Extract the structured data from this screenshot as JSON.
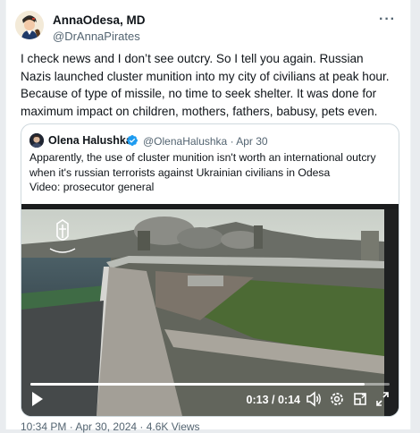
{
  "author": {
    "name": "AnnaOdesa, MD",
    "handle": "@DrAnnaPirates"
  },
  "more_label": "···",
  "tweet_text": "I check news and I don’t see outcry. So I tell you again. Russian Nazis launched cluster munition into my city of civilians at peak hour. Because of type of missile, no time to seek shelter. It was done for maximum impact on children, mothers, fathers, babusy, pets even.",
  "quote": {
    "name": "Olena Halushka",
    "handle": "@OlenaHalushka",
    "separator": "·",
    "date": "Apr 30",
    "text_line1": "Apparently, the use of cluster munition isn't worth an international outcry",
    "text_line2": "when it's russian terrorists against Ukrainian civilians in Odesa",
    "text_line3": "Video: prosecutor general"
  },
  "video": {
    "current_time": "0:13",
    "duration": "0:14",
    "time_separator": " / ",
    "progress": 0.93
  },
  "icons": {
    "play": "play-icon",
    "volume": "volume-icon",
    "settings": "settings-icon",
    "pip": "picture-in-picture-icon",
    "fullscreen": "fullscreen-icon",
    "verified": "verified-badge-icon"
  },
  "colors": {
    "verified_blue": "#1d9bf0",
    "secondary_text": "#536471"
  },
  "footer_text": "10:34 PM · Apr 30, 2024 · 4.6K Views"
}
